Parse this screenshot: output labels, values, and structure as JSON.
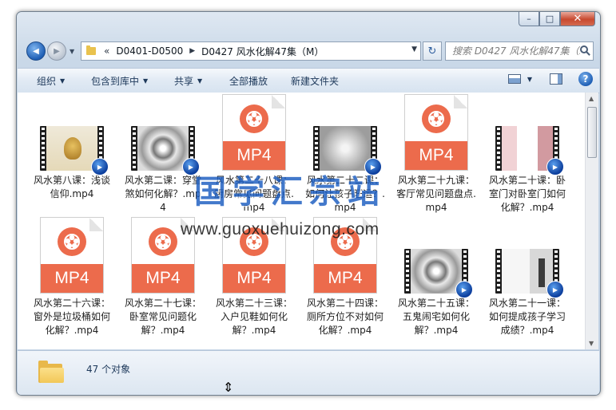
{
  "window": {
    "caption": {
      "minimize": "–",
      "maximize": "□",
      "close": "✕"
    }
  },
  "nav": {
    "back_icon": "◀",
    "forward_icon": "▶",
    "recent_icon": "▼",
    "breadcrumb_prefix": "«",
    "breadcrumbs": [
      "D0401-D0500",
      "D0427 风水化解47集（M）"
    ],
    "refresh_icon": "↻",
    "search_placeholder": "搜索 D0427 风水化解47集（..."
  },
  "toolbar": {
    "organize": "组织",
    "include_in_library": "包含到库中",
    "share": "共享",
    "play_all": "全部播放",
    "new_folder": "新建文件夹",
    "help": "?"
  },
  "files": [
    {
      "name": "风水第八课：浅谈信仰.mp4",
      "kind": "video",
      "thumb": "buddha"
    },
    {
      "name": "风水第二课：穿堂煞如何化解？.mp4",
      "kind": "video",
      "thumb": "ink"
    },
    {
      "name": "风水第二十八课：厨房常见问题盘点.mp4",
      "kind": "mp4",
      "band": "MP4"
    },
    {
      "name": "风水第二十二课：如何让孩子旺运？.mp4",
      "kind": "video",
      "thumb": "gray"
    },
    {
      "name": "风水第二十九课：客厅常见问题盘点.mp4",
      "kind": "mp4",
      "band": "MP4"
    },
    {
      "name": "风水第二十课：卧室门对卧室门如何化解？.mp4",
      "kind": "video",
      "thumb": "room"
    },
    {
      "name": "风水第二十六课：窗外是垃圾桶如何化解？.mp4",
      "kind": "mp4",
      "band": "MP4"
    },
    {
      "name": "风水第二十七课：卧室常见问题化解？.mp4",
      "kind": "mp4",
      "band": "MP4"
    },
    {
      "name": "风水第二十三课：入户见鞋如何化解？.mp4",
      "kind": "mp4",
      "band": "MP4"
    },
    {
      "name": "风水第二十四课：厕所方位不对如何化解？.mp4",
      "kind": "mp4",
      "band": "MP4"
    },
    {
      "name": "风水第二十五课：五鬼闹宅如何化解？.mp4",
      "kind": "video",
      "thumb": "ink"
    },
    {
      "name": "风水第二十一课：如何提成孩子学习成绩？.mp4",
      "kind": "video",
      "thumb": "child"
    }
  ],
  "status": {
    "count_text": "47 个对象"
  },
  "watermark": {
    "cn": "国学汇宗站",
    "url": "www.guoxuehuizong.com"
  },
  "colors": {
    "mp4_accent": "#ec6b4c",
    "watermark_blue": "#1a5cc0"
  }
}
